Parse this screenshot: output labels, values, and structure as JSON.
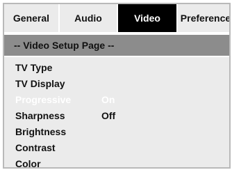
{
  "tabs": [
    {
      "label": "General"
    },
    {
      "label": "Audio"
    },
    {
      "label": "Video"
    },
    {
      "label": "Preference"
    }
  ],
  "active_tab": "Video",
  "page_title": "-- Video Setup Page --",
  "settings": [
    {
      "label": "TV Type",
      "value": ""
    },
    {
      "label": "TV Display",
      "value": ""
    },
    {
      "label": "Progressive",
      "value": "On"
    },
    {
      "label": "Sharpness",
      "value": "Off"
    },
    {
      "label": "Brightness",
      "value": ""
    },
    {
      "label": "Contrast",
      "value": ""
    },
    {
      "label": "Color",
      "value": ""
    }
  ],
  "highlighted_setting": "Progressive",
  "colors": {
    "active_tab_bg": "#000000",
    "title_bar_bg": "#8c8c8c",
    "panel_bg": "#ebebeb",
    "highlight_text": "#ffffff"
  }
}
